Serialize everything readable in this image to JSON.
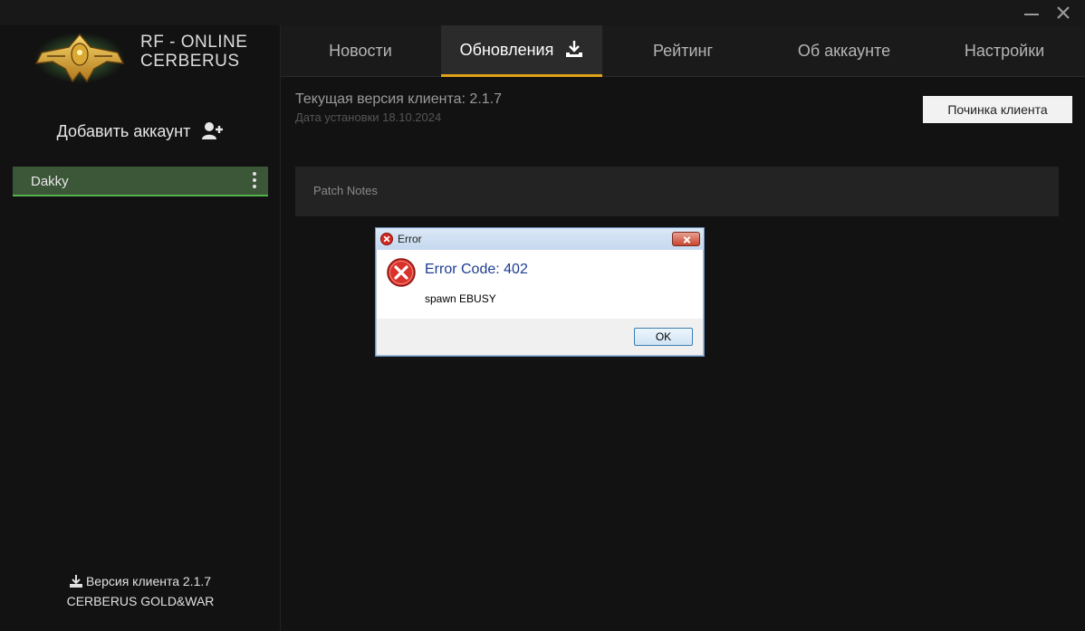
{
  "brand": {
    "line1": "RF - ONLINE",
    "line2": "CERBERUS",
    "logo_icon": "golden-spaceship-logo-icon"
  },
  "window": {
    "minimize_icon": "minimize-icon",
    "close_icon": "close-icon"
  },
  "sidebar": {
    "add_account_label": "Добавить аккаунт",
    "add_account_icon": "user-plus-icon",
    "accounts": [
      {
        "name": "Dakky",
        "menu_icon": "kebab-menu-icon"
      }
    ],
    "footer_version": "Версия клиента 2.1.7",
    "footer_server": "CERBERUS GOLD&WAR",
    "footer_icon": "download-icon"
  },
  "nav": {
    "tabs": [
      {
        "label": "Новости"
      },
      {
        "label": "Обновления",
        "icon": "download-icon",
        "active": true
      },
      {
        "label": "Рейтинг"
      },
      {
        "label": "Об аккаунте"
      },
      {
        "label": "Настройки"
      }
    ]
  },
  "main": {
    "current_version": "Текущая версия клиента: 2.1.7",
    "install_date": "Дата установки 18.10.2024",
    "repair_button": "Починка клиента",
    "patch_notes_label": "Patch Notes"
  },
  "dialog": {
    "title": "Error",
    "heading": "Error Code: 402",
    "message": "spawn EBUSY",
    "ok_label": "OK",
    "icon": "error-icon"
  },
  "colors": {
    "accent_tab_underline": "#e0a21a",
    "account_bg": "#3c5638",
    "account_underline": "#53b14a",
    "dialog_heading": "#1c3c92"
  }
}
